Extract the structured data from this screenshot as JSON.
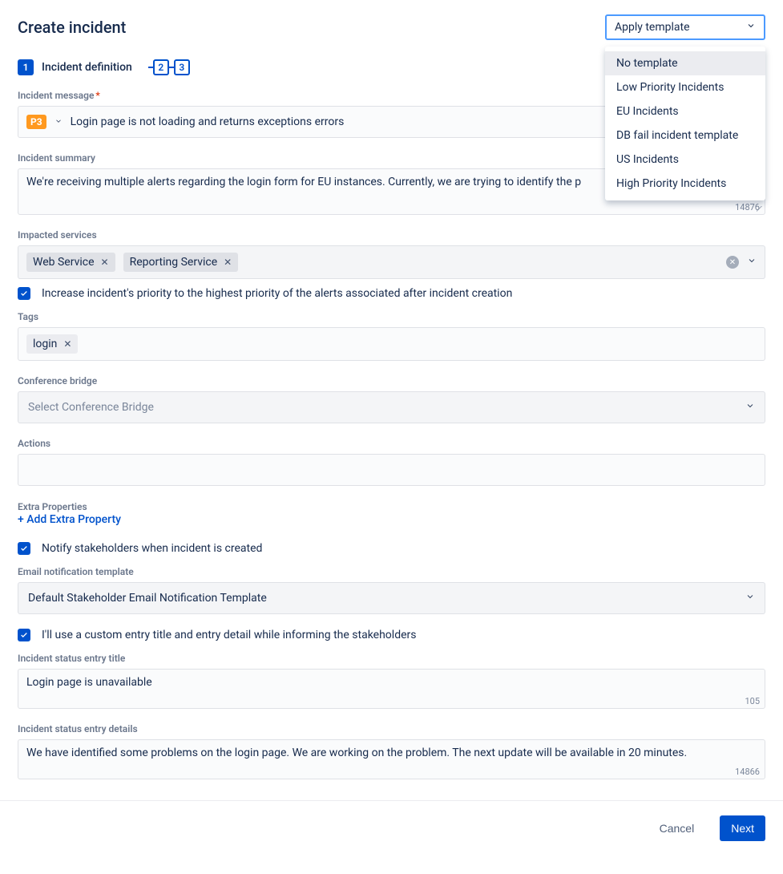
{
  "header": {
    "title": "Create incident",
    "template_trigger_label": "Apply template",
    "template_options": [
      "No template",
      "Low Priority Incidents",
      "EU Incidents",
      "DB fail incident template",
      "US Incidents",
      "High Priority Incidents"
    ]
  },
  "stepper": {
    "step1_num": "1",
    "step1_label": "Incident definition",
    "step2_num": "2",
    "step3_num": "3"
  },
  "form": {
    "message": {
      "label": "Incident message",
      "priority_badge": "P3",
      "value": "Login page is not loading and returns exceptions errors"
    },
    "summary": {
      "label": "Incident summary",
      "value": "We're receiving multiple alerts regarding the login form for EU instances. Currently, we are trying to identify the p",
      "count": "14876"
    },
    "impacted": {
      "label": "Impacted services",
      "services": [
        "Web Service",
        "Reporting Service"
      ]
    },
    "increase_priority_checkbox": "Increase incident's priority to the highest priority of the alerts associated after incident creation",
    "tags": {
      "label": "Tags",
      "items": [
        "login"
      ]
    },
    "conference": {
      "label": "Conference bridge",
      "placeholder": "Select Conference Bridge"
    },
    "actions": {
      "label": "Actions"
    },
    "extra_properties": {
      "label": "Extra Properties",
      "link": "+ Add Extra Property"
    },
    "notify_checkbox": "Notify stakeholders when incident is created",
    "email_template": {
      "label": "Email notification template",
      "value": "Default Stakeholder Email Notification Template"
    },
    "custom_entry_checkbox": "I'll use a custom entry title and entry detail while informing the stakeholders",
    "status_title": {
      "label": "Incident status entry title",
      "value": "Login page is unavailable",
      "count": "105"
    },
    "status_details": {
      "label": "Incident status entry details",
      "value": "We have identified some problems on the login page. We are working on the problem. The next update will be available in 20 minutes.",
      "count": "14866"
    }
  },
  "footer": {
    "cancel": "Cancel",
    "next": "Next"
  }
}
